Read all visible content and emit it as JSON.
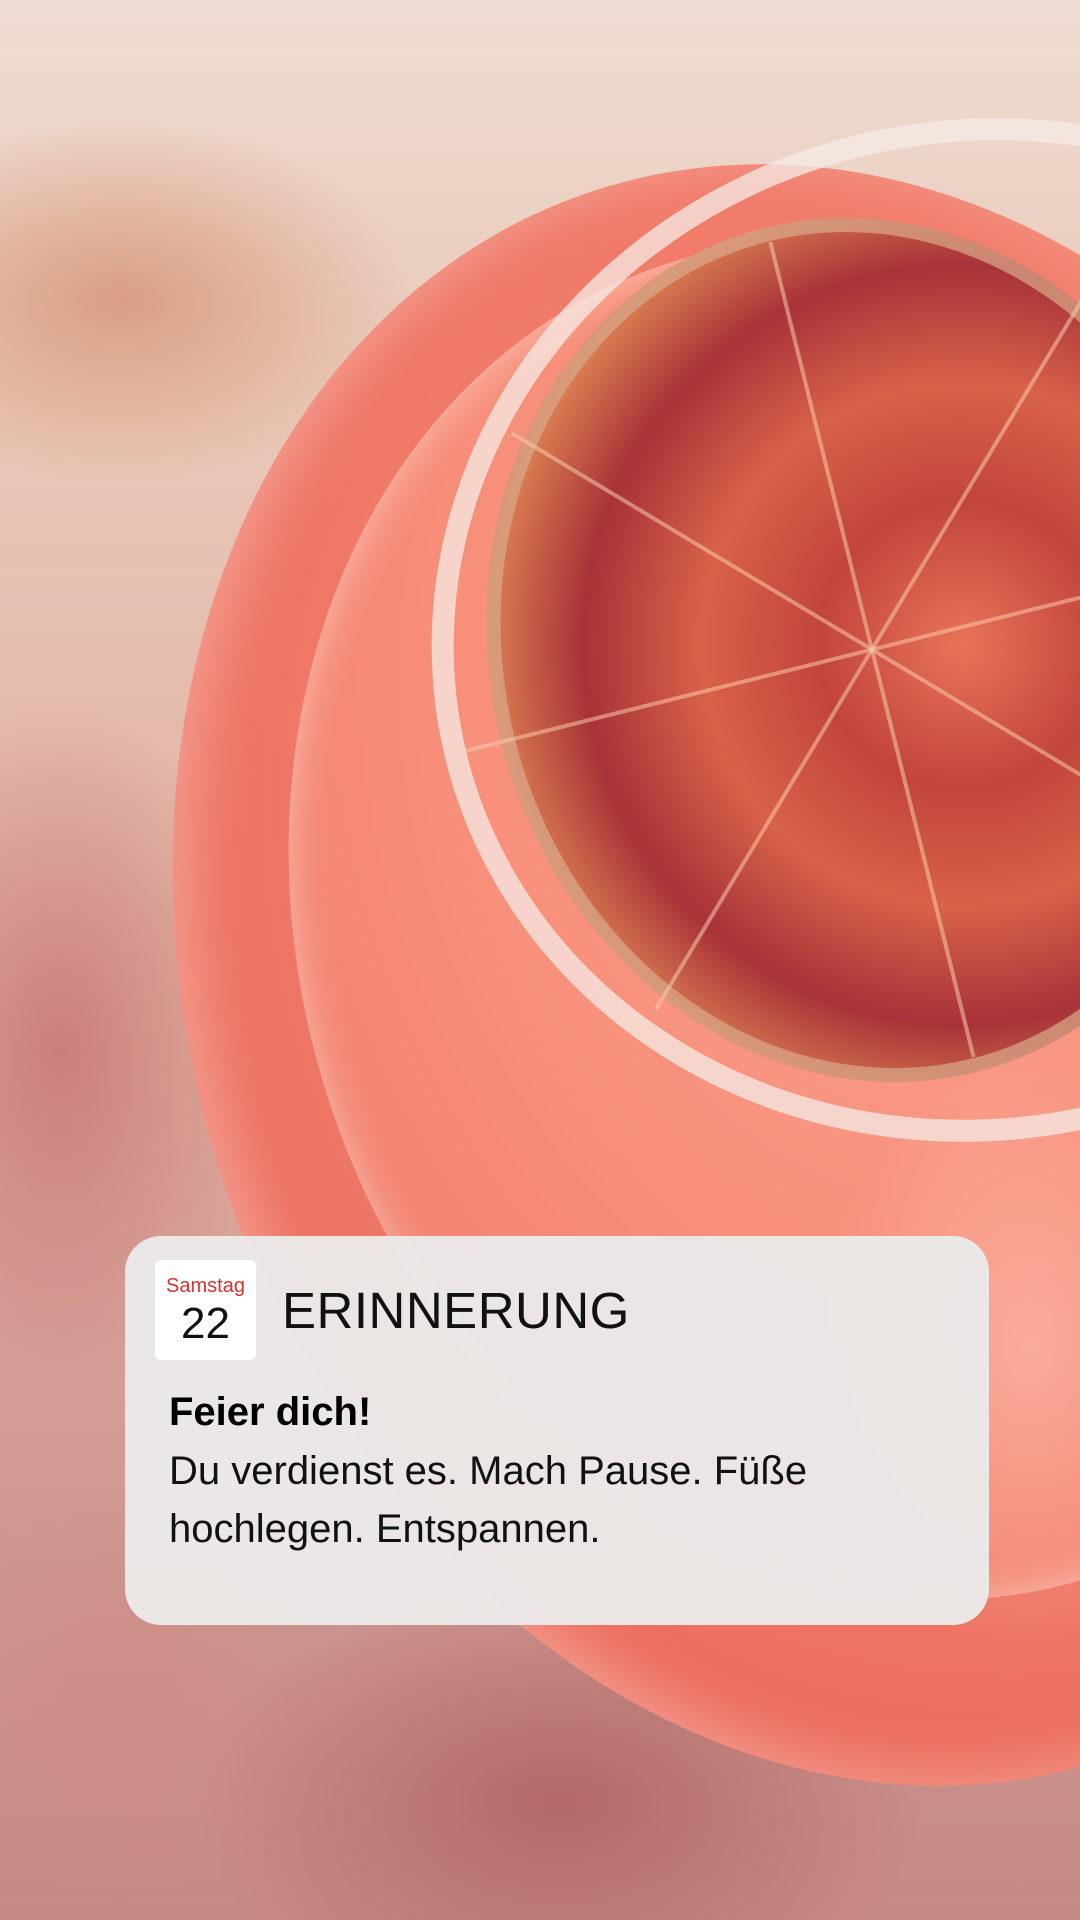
{
  "background": {
    "description_colors": {
      "drink": "#f3816f",
      "slice": "#c2453c",
      "backdrop": "#e9c9b8"
    }
  },
  "notification": {
    "calendar_icon": {
      "weekday": "Samstag",
      "day": "22",
      "weekday_color": "#d9302f"
    },
    "app_name": "ERINNERUNG",
    "title": "Feier dich!",
    "body": "Du verdienst es. Mach Pause. Füße hochlegen. Entspannen."
  }
}
